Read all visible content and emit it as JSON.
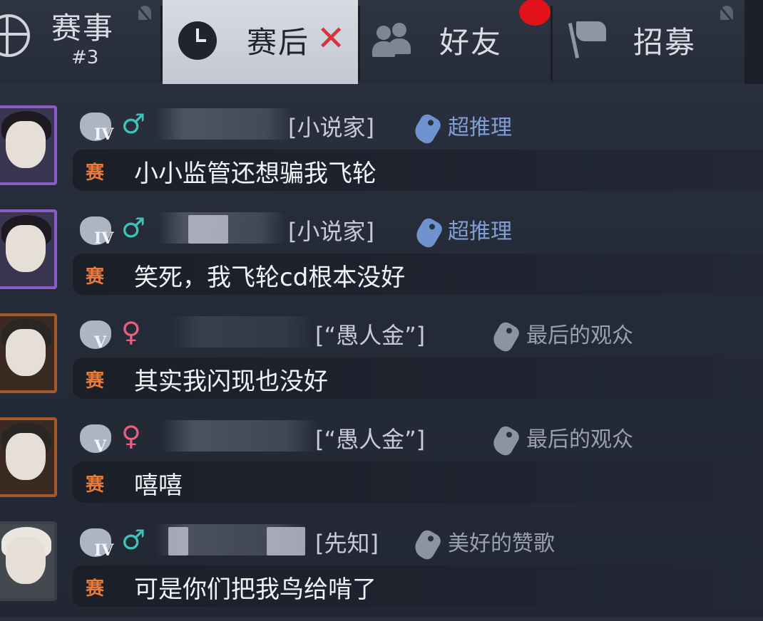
{
  "tabs": {
    "events": {
      "label": "赛事",
      "sub": "#3"
    },
    "post_match": {
      "label": "赛后"
    },
    "friends": {
      "label": "好友"
    },
    "recruit": {
      "label": "招募"
    }
  },
  "colors": {
    "accent_red": "#e2121b",
    "male": "#3fc2b8",
    "female": "#e7607e",
    "channel": "#e97b3c",
    "badge_blue": "#7e9ed4"
  },
  "messages": [
    {
      "rank": "IV",
      "gender_symbol": "♂",
      "title": "[小说家]",
      "badge": "超推理",
      "channel": "赛",
      "text": "小小监管还想骗我飞轮"
    },
    {
      "rank": "IV",
      "gender_symbol": "♂",
      "title": "[小说家]",
      "badge": "超推理",
      "channel": "赛",
      "text": "笑死，我飞轮cd根本没好"
    },
    {
      "rank": "V",
      "gender_symbol": "♀",
      "title": "[“愚人金”]",
      "badge": "最后的观众",
      "channel": "赛",
      "text": "其实我闪现也没好"
    },
    {
      "rank": "V",
      "gender_symbol": "♀",
      "title": "[“愚人金”]",
      "badge": "最后的观众",
      "channel": "赛",
      "text": "嘻嘻"
    },
    {
      "rank": "IV",
      "gender_symbol": "♂",
      "title": "[先知]",
      "badge": "美好的赞歌",
      "channel": "赛",
      "text": "可是你们把我鸟给啃了"
    }
  ]
}
